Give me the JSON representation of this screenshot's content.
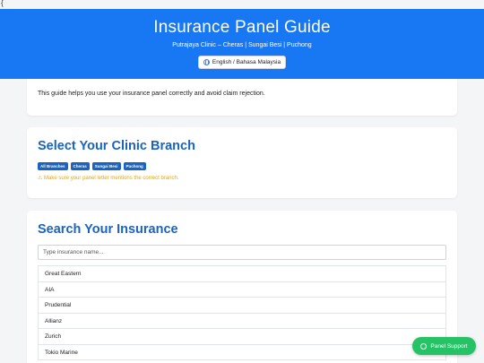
{
  "stray_char": "{",
  "header": {
    "title": "Insurance Panel Guide",
    "subtitle": "Putrajaya Clinic – Cheras | Sungai Besi | Puchong",
    "language_button": "English / Bahasa Malaysia",
    "background": "#1877f2"
  },
  "intro": {
    "text": "This guide helps you use your insurance panel correctly and avoid claim rejection."
  },
  "branch_section": {
    "title": "Select Your Clinic Branch",
    "branches": [
      "All Branches",
      "Cheras",
      "Sungai Besi",
      "Puchong"
    ],
    "warning": "⚠ Make sure your panel letter mentions the correct branch."
  },
  "search_section": {
    "title": "Search Your Insurance",
    "placeholder": "Type insurance name...",
    "insurers": [
      "Great Eastern",
      "AIA",
      "Prudential",
      "Allianz",
      "Zurich",
      "Tokio Marine"
    ]
  },
  "floating_button": {
    "label": "Panel Support",
    "icon": "whatsapp-icon",
    "color": "#25c266"
  }
}
